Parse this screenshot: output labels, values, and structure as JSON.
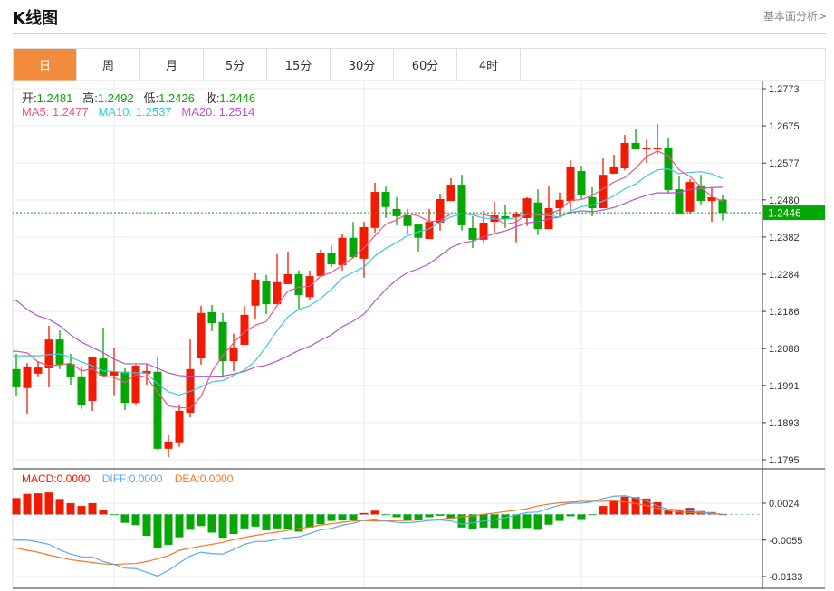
{
  "header": {
    "title": "K线图",
    "fundamental_link": "基本面分析>"
  },
  "tabs": [
    {
      "label": "日",
      "active": true
    },
    {
      "label": "周"
    },
    {
      "label": "月"
    },
    {
      "label": "5分"
    },
    {
      "label": "15分"
    },
    {
      "label": "30分"
    },
    {
      "label": "60分"
    },
    {
      "label": "4时"
    }
  ],
  "ohlc_legend": {
    "open_label": "开:",
    "open": "1.2481",
    "high_label": "高:",
    "high": "1.2492",
    "low_label": "低:",
    "low": "1.2426",
    "close_label": "收:",
    "close": "1.2446"
  },
  "ma_legend": {
    "ma5_label": "MA5: ",
    "ma5": "1.2477",
    "ma10_label": "MA10: ",
    "ma10": "1.2537",
    "ma20_label": "MA20: ",
    "ma20": "1.2514"
  },
  "macd_legend": {
    "macd_label": "MACD:",
    "macd": "0.0000",
    "diff_label": "DIFF:",
    "diff": "0.0000",
    "dea_label": "DEA:",
    "dea": "0.0000"
  },
  "colors": {
    "up": "#f21a00",
    "down": "#04a804",
    "tab_active": "#f28c3c",
    "ma5": "#f0558a",
    "ma10": "#3cc8dc",
    "ma20": "#b455c8",
    "diff": "#5aaaf0",
    "dea": "#f07828",
    "last_price": "#04a804"
  },
  "chart_data": [
    {
      "type": "candlestick",
      "ylim": [
        1.1795,
        1.2773
      ],
      "y_ticks": [
        "1.2773",
        "1.2675",
        "1.2577",
        "1.2480",
        "1.2382",
        "1.2284",
        "1.2186",
        "1.2088",
        "1.1991",
        "1.1893",
        "1.1795"
      ],
      "last_price": "1.2446",
      "grid": true,
      "candles": [
        [
          1.2034,
          1.1986,
          1.2074,
          1.1965
        ],
        [
          1.1984,
          1.2041,
          1.205,
          1.1917
        ],
        [
          1.2022,
          1.2038,
          1.2055,
          1.2015
        ],
        [
          1.2036,
          1.2112,
          1.2148,
          1.1986
        ],
        [
          1.2112,
          1.2046,
          1.2136,
          1.2034
        ],
        [
          1.2048,
          1.2012,
          1.2074,
          1.1993
        ],
        [
          1.2015,
          1.1938,
          1.2041,
          1.1929
        ],
        [
          1.195,
          1.2065,
          1.2067,
          1.1924
        ],
        [
          1.2062,
          1.2017,
          1.2143,
          1.2017
        ],
        [
          1.2017,
          1.2027,
          1.2089,
          1.1965
        ],
        [
          1.2027,
          1.1945,
          1.2036,
          1.1926
        ],
        [
          1.1945,
          1.2043,
          1.2046,
          1.1941
        ],
        [
          1.2022,
          1.2029,
          1.2048,
          1.1993
        ],
        [
          1.2027,
          1.1824,
          1.2065,
          1.1821
        ],
        [
          1.1824,
          1.1843,
          1.186,
          1.1802
        ],
        [
          1.1841,
          1.1924,
          1.1941,
          1.1829
        ],
        [
          1.1919,
          1.2034,
          1.2112,
          1.1907
        ],
        [
          1.2062,
          1.2182,
          1.2201,
          1.2046
        ],
        [
          1.2184,
          1.2155,
          1.2203,
          1.2134
        ],
        [
          1.2158,
          1.2055,
          1.2182,
          1.2012
        ],
        [
          1.2055,
          1.2091,
          1.2127,
          1.2029
        ],
        [
          1.2098,
          1.2177,
          1.2201,
          1.2098
        ],
        [
          1.2201,
          1.227,
          1.2287,
          1.2167
        ],
        [
          1.2267,
          1.2205,
          1.2282,
          1.2179
        ],
        [
          1.2205,
          1.2263,
          1.2337,
          1.2205
        ],
        [
          1.2258,
          1.2284,
          1.2344,
          1.2258
        ],
        [
          1.2284,
          1.2229,
          1.2294,
          1.2193
        ],
        [
          1.2224,
          1.2279,
          1.2294,
          1.2217
        ],
        [
          1.2279,
          1.2341,
          1.2349,
          1.2279
        ],
        [
          1.2341,
          1.231,
          1.236,
          1.2303
        ],
        [
          1.2308,
          1.238,
          1.2391,
          1.2294
        ],
        [
          1.238,
          1.2329,
          1.2422,
          1.2325
        ],
        [
          1.2325,
          1.2408,
          1.2422,
          1.2275
        ],
        [
          1.2406,
          1.2501,
          1.2525,
          1.2394
        ],
        [
          1.2501,
          1.2461,
          1.2515,
          1.2432
        ],
        [
          1.2456,
          1.2437,
          1.2487,
          1.2413
        ],
        [
          1.2439,
          1.2411,
          1.2456,
          1.2389
        ],
        [
          1.2415,
          1.238,
          1.2415,
          1.2344
        ],
        [
          1.2377,
          1.2422,
          1.2456,
          1.2377
        ],
        [
          1.242,
          1.2482,
          1.2496,
          1.2399
        ],
        [
          1.2477,
          1.252,
          1.2537,
          1.2477
        ],
        [
          1.252,
          1.2413,
          1.2546,
          1.2399
        ],
        [
          1.2406,
          1.2375,
          1.2437,
          1.2353
        ],
        [
          1.2375,
          1.242,
          1.2451,
          1.2365
        ],
        [
          1.2422,
          1.2439,
          1.2475,
          1.2394
        ],
        [
          1.2437,
          1.243,
          1.2468,
          1.2406
        ],
        [
          1.2434,
          1.2444,
          1.2449,
          1.2368
        ],
        [
          1.2432,
          1.2484,
          1.2487,
          1.2411
        ],
        [
          1.2473,
          1.2403,
          1.2508,
          1.2387
        ],
        [
          1.2403,
          1.2458,
          1.2515,
          1.2403
        ],
        [
          1.2458,
          1.248,
          1.2499,
          1.2437
        ],
        [
          1.2477,
          1.2568,
          1.2585,
          1.2453
        ],
        [
          1.2556,
          1.2494,
          1.257,
          1.2482
        ],
        [
          1.2487,
          1.2458,
          1.2513,
          1.2437
        ],
        [
          1.2458,
          1.2546,
          1.2589,
          1.2458
        ],
        [
          1.2549,
          1.2568,
          1.2599,
          1.2549
        ],
        [
          1.2563,
          1.263,
          1.2651,
          1.2558
        ],
        [
          1.263,
          1.2613,
          1.2668,
          1.2613
        ],
        [
          1.2613,
          1.2616,
          1.2639,
          1.2577
        ],
        [
          1.2613,
          1.2616,
          1.268,
          1.2601
        ],
        [
          1.2616,
          1.2506,
          1.2642,
          1.2499
        ],
        [
          1.2508,
          1.2444,
          1.2542,
          1.2444
        ],
        [
          1.2449,
          1.2527,
          1.2535,
          1.2444
        ],
        [
          1.2518,
          1.2477,
          1.2546,
          1.2465
        ],
        [
          1.2477,
          1.2487,
          1.2511,
          1.2422
        ],
        [
          1.2481,
          1.2446,
          1.2492,
          1.2426
        ]
      ],
      "candle_fields": [
        "open",
        "close",
        "high",
        "low"
      ],
      "ma5": [
        1.2081,
        1.2077,
        1.2053,
        1.2043
      ],
      "ma10": [
        1.2069,
        1.2069,
        1.2069,
        1.2072,
        1.2074,
        1.2065,
        1.2053,
        1.2043,
        1.2029
      ],
      "ma20": [
        1.2215,
        1.2191,
        1.2174,
        1.2165,
        1.2148,
        1.2124,
        1.2105,
        1.2091,
        1.2077,
        1.206,
        1.2048,
        1.2048,
        1.2048,
        1.2036,
        1.2024,
        1.2017,
        1.2015,
        1.2015,
        1.2015
      ]
    },
    {
      "type": "macd",
      "ylim": [
        -0.0133,
        0.0024
      ],
      "y_ticks": [
        "0.0024",
        "-0.0055",
        "-0.0133"
      ],
      "macd": [
        0.0035,
        0.0044,
        0.0045,
        0.0047,
        0.0033,
        0.0024,
        0.0018,
        0.0024,
        0.001,
        -0.0001,
        -0.0018,
        -0.0023,
        -0.0046,
        -0.0073,
        -0.0065,
        -0.0049,
        -0.0033,
        -0.0025,
        -0.0039,
        -0.005,
        -0.0042,
        -0.003,
        -0.0026,
        -0.0034,
        -0.003,
        -0.0032,
        -0.0037,
        -0.0028,
        -0.0021,
        -0.0014,
        -0.0013,
        -0.0012,
        0.0003,
        0.0008,
        -0.0001,
        -0.0006,
        -0.0013,
        -0.0012,
        -0.0006,
        -0.0003,
        -0.0009,
        -0.0028,
        -0.0032,
        -0.0028,
        -0.0029,
        -0.003,
        -0.003,
        -0.0029,
        -0.0033,
        -0.0022,
        -0.0014,
        -0.0004,
        -0.001,
        -0.0001,
        0.0018,
        0.0029,
        0.0038,
        0.0037,
        0.0034,
        0.0026,
        0.0011,
        0.0008,
        0.0014,
        0.0007,
        0.0005,
        0.0
      ],
      "diff": [
        -0.0055,
        -0.0055,
        -0.0059,
        -0.0064,
        -0.0076,
        -0.0085,
        -0.0091,
        -0.0091,
        -0.0101,
        -0.0107,
        -0.0115,
        -0.0116,
        -0.0124,
        -0.0132,
        -0.012,
        -0.0104,
        -0.0089,
        -0.0081,
        -0.0084,
        -0.0085,
        -0.0075,
        -0.0064,
        -0.0058,
        -0.0058,
        -0.0053,
        -0.005,
        -0.0048,
        -0.0041,
        -0.0033,
        -0.003,
        -0.0023,
        -0.0019,
        -0.0012,
        -0.001,
        -0.0014,
        -0.0017,
        -0.0018,
        -0.0016,
        -0.0013,
        -0.0012,
        -0.0014,
        -0.0021,
        -0.0018,
        -0.0014,
        -0.0012,
        -0.0007,
        -0.0001,
        0.0004,
        0.0005,
        0.0013,
        0.002,
        0.0024,
        0.0024,
        0.0027,
        0.0034,
        0.0039,
        0.004,
        0.0035,
        0.0029,
        0.0018,
        0.0011,
        0.001,
        0.0008,
        0.0005,
        0.0003,
        0.0
      ],
      "dea": [
        -0.0072,
        -0.0077,
        -0.0081,
        -0.0087,
        -0.0092,
        -0.0097,
        -0.01,
        -0.0103,
        -0.0106,
        -0.0107,
        -0.0106,
        -0.0105,
        -0.0101,
        -0.0095,
        -0.0088,
        -0.0077,
        -0.0072,
        -0.0068,
        -0.0064,
        -0.006,
        -0.0054,
        -0.0049,
        -0.0045,
        -0.0041,
        -0.0038,
        -0.0034,
        -0.003,
        -0.0027,
        -0.0023,
        -0.002,
        -0.0017,
        -0.0014,
        -0.0013,
        -0.0014,
        -0.0014,
        -0.0013,
        -0.0013,
        -0.0012,
        -0.0011,
        -0.001,
        -0.0008,
        -0.0005,
        -0.0003,
        0.0,
        0.0003,
        0.0006,
        0.0009,
        0.0012,
        0.0018,
        0.0022,
        0.0025,
        0.0026,
        0.0028,
        0.0028,
        0.0028,
        0.0029,
        0.0027,
        0.0023,
        0.0019,
        0.0013,
        0.0008,
        0.0005,
        0.0004,
        0.0003,
        0.0002,
        0.0
      ]
    }
  ]
}
